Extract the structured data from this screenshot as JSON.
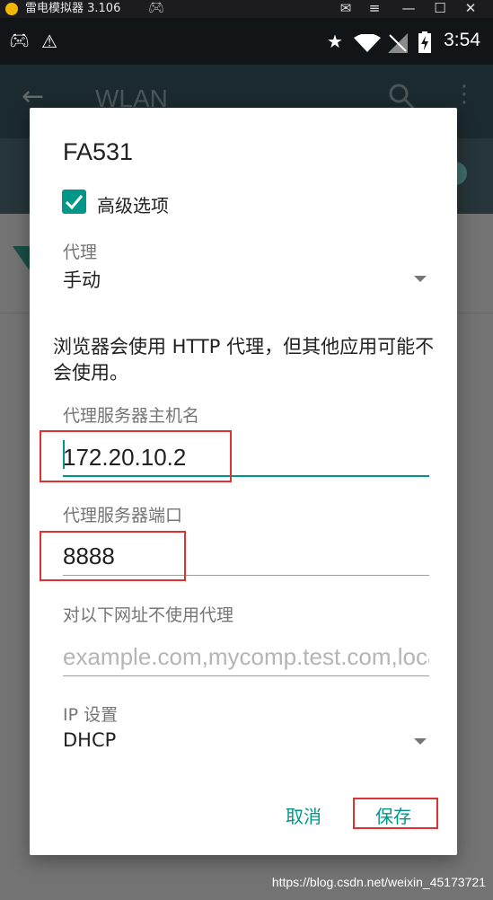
{
  "emulator": {
    "title": "雷电模拟器 3.106",
    "icons": [
      "emulator-logo-icon",
      "gamepad-icon",
      "mail-icon",
      "menu-icon",
      "minimize-icon",
      "maximize-icon",
      "close-icon"
    ]
  },
  "status_bar": {
    "time": "3:54",
    "icons": [
      "gamepad-icon",
      "warning-icon",
      "star-icon",
      "wifi-icon",
      "no-signal-icon",
      "battery-charging-icon"
    ]
  },
  "background_app": {
    "title": "WLAN"
  },
  "dialog": {
    "title": "FA531",
    "advanced_options_label": "高级选项",
    "advanced_options_checked": true,
    "proxy": {
      "label": "代理",
      "value": "手动"
    },
    "notice": "浏览器会使用 HTTP 代理，但其他应用可能不会使用。",
    "hostname": {
      "label": "代理服务器主机名",
      "value": "172.20.10.2"
    },
    "port": {
      "label": "代理服务器端口",
      "value": "8888"
    },
    "bypass": {
      "label": "对以下网址不使用代理",
      "placeholder": "example.com,mycomp.test.com,localhost"
    },
    "ip_settings": {
      "label": "IP 设置",
      "value": "DHCP"
    },
    "buttons": {
      "cancel": "取消",
      "save": "保存"
    }
  },
  "watermark": "https://blog.csdn.net/weixin_45173721",
  "colors": {
    "accent": "#009688",
    "highlight": "#e03030",
    "scrim": "#737373"
  }
}
